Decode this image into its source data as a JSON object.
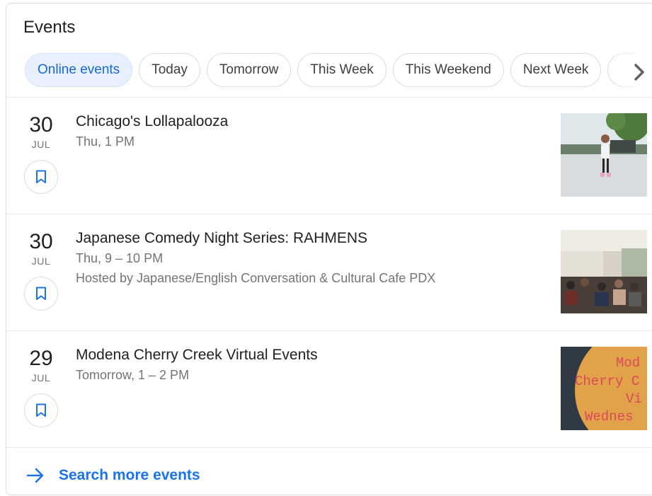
{
  "header": {
    "title": "Events"
  },
  "chips": [
    {
      "label": "Online events",
      "active": true
    },
    {
      "label": "Today",
      "active": false
    },
    {
      "label": "Tomorrow",
      "active": false
    },
    {
      "label": "This Week",
      "active": false
    },
    {
      "label": "This Weekend",
      "active": false
    },
    {
      "label": "Next Week",
      "active": false
    }
  ],
  "chip_scroll_icon": "chevron-right-icon",
  "events": [
    {
      "day": "30",
      "month": "JUL",
      "title": "Chicago's Lollapalooza",
      "time": "Thu, 1 PM",
      "host": "",
      "image": "girl-dancing-outdoors-photo"
    },
    {
      "day": "30",
      "month": "JUL",
      "title": "Japanese Comedy Night Series: RAHMENS",
      "time": "Thu, 9 – 10 PM",
      "host": "Hosted by Japanese/English Conversation & Cultural Cafe PDX",
      "image": "cafe-audience-photo"
    },
    {
      "day": "29",
      "month": "JUL",
      "title": "Modena Cherry Creek Virtual Events",
      "time": "Tomorrow, 1 – 2 PM",
      "host": "",
      "image": "modena-promo-graphic",
      "image_text": [
        "Mod",
        "Cherry C",
        "Vi",
        "Wednes"
      ]
    }
  ],
  "footer": {
    "label": "Search more events",
    "icon": "arrow-right-icon"
  },
  "colors": {
    "accent": "#1a73e8",
    "chip_active_bg": "#e8f0fe",
    "chip_active_text": "#1967d2",
    "secondary_text": "#70757a"
  }
}
